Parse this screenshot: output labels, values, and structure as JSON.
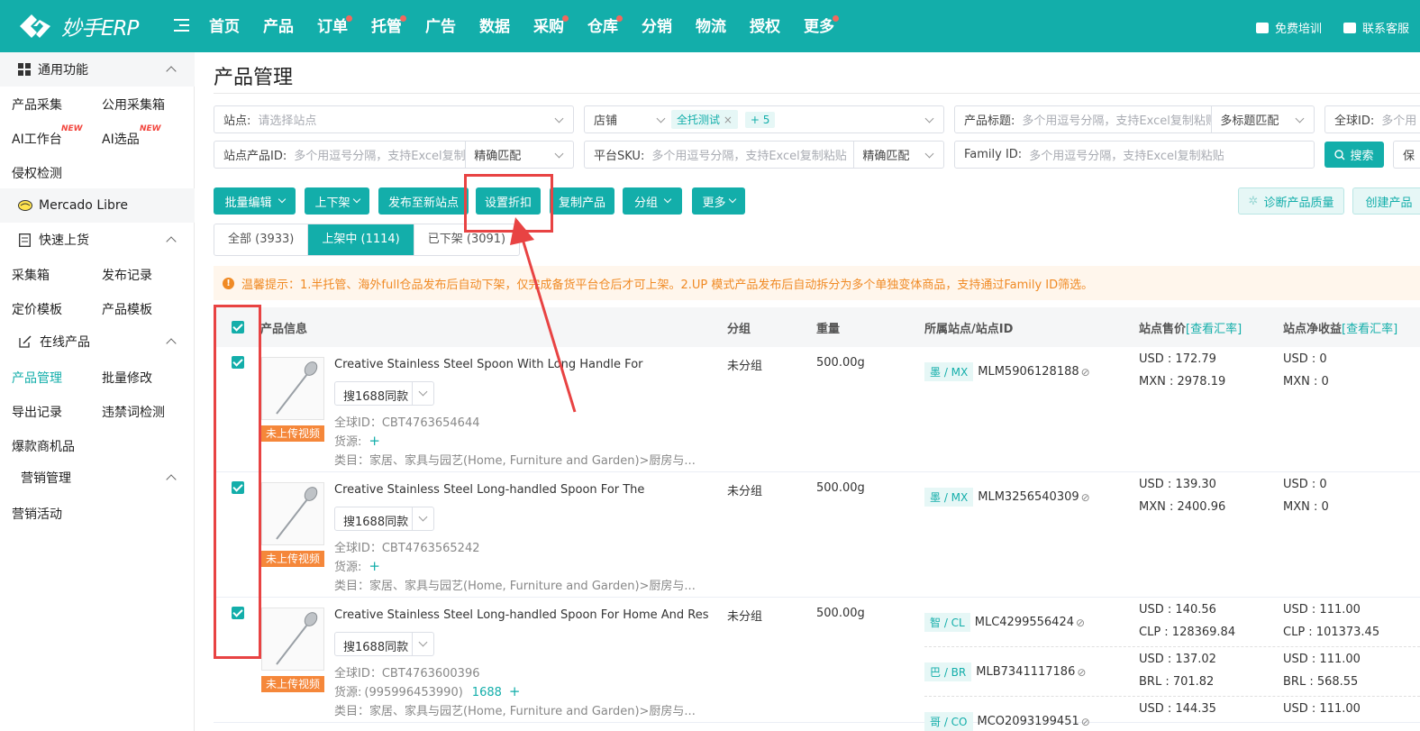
{
  "app": {
    "logo_text": "妙手ERP"
  },
  "nav": {
    "items": [
      {
        "label": "首页",
        "dot": false
      },
      {
        "label": "产品",
        "dot": false
      },
      {
        "label": "订单",
        "dot": true
      },
      {
        "label": "托管",
        "dot": true
      },
      {
        "label": "广告",
        "dot": false
      },
      {
        "label": "数据",
        "dot": false
      },
      {
        "label": "采购",
        "dot": true
      },
      {
        "label": "仓库",
        "dot": true
      },
      {
        "label": "分销",
        "dot": false
      },
      {
        "label": "物流",
        "dot": false
      },
      {
        "label": "授权",
        "dot": false
      },
      {
        "label": "更多",
        "dot": true
      }
    ],
    "training": "免费培训",
    "support": "联系客服"
  },
  "sidebar": {
    "general": {
      "title": "通用功能",
      "items": [
        "产品采集",
        "公用采集箱",
        "AI工作台",
        "AI选品",
        "侵权检测"
      ],
      "new_label": "NEW"
    },
    "platform": "Mercado Libre",
    "quick": {
      "title": "快速上货",
      "items": [
        "采集箱",
        "发布记录",
        "定价模板",
        "产品模板"
      ]
    },
    "online": {
      "title": "在线产品",
      "items": [
        "产品管理",
        "批量修改",
        "导出记录",
        "违禁词检测",
        "爆款商机品"
      ]
    },
    "marketing": {
      "title": "营销管理",
      "items": [
        "营销活动"
      ]
    }
  },
  "page": {
    "title": "产品管理"
  },
  "filters": {
    "site_label": "站点:",
    "site_placeholder": "请选择站点",
    "shop_label": "店铺",
    "shop_tag": "全托测试",
    "shop_more": "+ 5",
    "title_label": "产品标题:",
    "title_placeholder": "多个用逗号分隔，支持Excel复制粘贴",
    "title_match": "多标题匹配",
    "global_id_label": "全球ID:",
    "global_id_placeholder": "多个用",
    "site_pid_label": "站点产品ID:",
    "site_pid_placeholder": "多个用逗号分隔，支持Excel复制粘",
    "exact_match": "精确匹配",
    "sku_label": "平台SKU:",
    "sku_placeholder": "多个用逗号分隔，支持Excel复制粘贴",
    "sku_match": "精确匹配",
    "family_label": "Family ID:",
    "family_placeholder": "多个用逗号分隔，支持Excel复制粘贴",
    "search_button": "搜索",
    "save_button": "保"
  },
  "toolbar": {
    "batch_edit": "批量编辑",
    "shelf": "上下架",
    "publish_new_site": "发布至新站点",
    "set_discount": "设置折扣",
    "copy_product": "复制产品",
    "group": "分组",
    "more": "更多",
    "diagnose": "诊断产品质量",
    "create": "创建产品"
  },
  "tabs": [
    {
      "label": "全部 (3933)",
      "active": false
    },
    {
      "label": "上架中 (1114)",
      "active": true
    },
    {
      "label": "已下架 (3091)",
      "active": false
    }
  ],
  "notice": "温馨提示：1.半托管、海外full仓品发布后自动下架，仅完成备货平台仓后才可上架。2.UP 模式产品发布后自动拆分为多个单独变体商品，支持通过Family ID筛选。",
  "table": {
    "headers": {
      "product_info": "产品信息",
      "group": "分组",
      "weight": "重量",
      "site": "所属站点/站点ID",
      "price": "站点售价",
      "price_link": "[查看汇率]",
      "net": "站点净收益",
      "net_link": "[查看汇率]"
    },
    "rows": [
      {
        "name": "Creative Stainless Steel Spoon With Long Handle For",
        "search_label": "搜1688同款",
        "video_tag": "未上传视频",
        "global_id": "全球ID：CBT4763654644",
        "source": "货源:",
        "source_value": "",
        "source_link": "",
        "category": "类目：家居、家具与园艺(Home, Furniture and Garden)>厨房与...",
        "group": "未分组",
        "weight": "500.00g",
        "sites": [
          {
            "badge": "墨 / MX",
            "id": "MLM5906128188",
            "price1": "USD : 172.79",
            "price2": "MXN : 2978.19",
            "net1": "USD : 0",
            "net2": "MXN : 0"
          }
        ]
      },
      {
        "name": "Creative Stainless Steel Long-handled Spoon For The",
        "search_label": "搜1688同款",
        "video_tag": "未上传视频",
        "global_id": "全球ID：CBT4763565242",
        "source": "货源:",
        "source_value": "",
        "source_link": "",
        "category": "类目：家居、家具与园艺(Home, Furniture and Garden)>厨房与...",
        "group": "未分组",
        "weight": "500.00g",
        "sites": [
          {
            "badge": "墨 / MX",
            "id": "MLM3256540309",
            "price1": "USD : 139.30",
            "price2": "MXN : 2400.96",
            "net1": "USD : 0",
            "net2": "MXN : 0"
          }
        ]
      },
      {
        "name": "Creative Stainless Steel Long-handled Spoon For Home And Res",
        "search_label": "搜1688同款",
        "video_tag": "未上传视频",
        "global_id": "全球ID：CBT4763600396",
        "source": "货源:",
        "source_value": "(995996453990)",
        "source_link": "1688",
        "category": "类目：家居、家具与园艺(Home, Furniture and Garden)>厨房与...",
        "group": "未分组",
        "weight": "500.00g",
        "sites": [
          {
            "badge": "智 / CL",
            "id": "MLC4299556424",
            "price1": "USD : 140.56",
            "price2": "CLP : 128369.84",
            "net1": "USD : 111.00",
            "net2": "CLP : 101373.45"
          },
          {
            "badge": "巴 / BR",
            "id": "MLB7341117186",
            "price1": "USD : 137.02",
            "price2": "BRL : 701.82",
            "net1": "USD : 111.00",
            "net2": "BRL : 568.55"
          },
          {
            "badge": "哥 / CO",
            "id": "MCO2093199451",
            "price1": "USD : 144.35",
            "price2": "",
            "net1": "USD : 111.00",
            "net2": ""
          }
        ]
      }
    ]
  },
  "colors": {
    "primary": "#13aeaa",
    "warning": "#f08a24",
    "annotation": "#e84343",
    "badge_orange": "#f5873a"
  }
}
